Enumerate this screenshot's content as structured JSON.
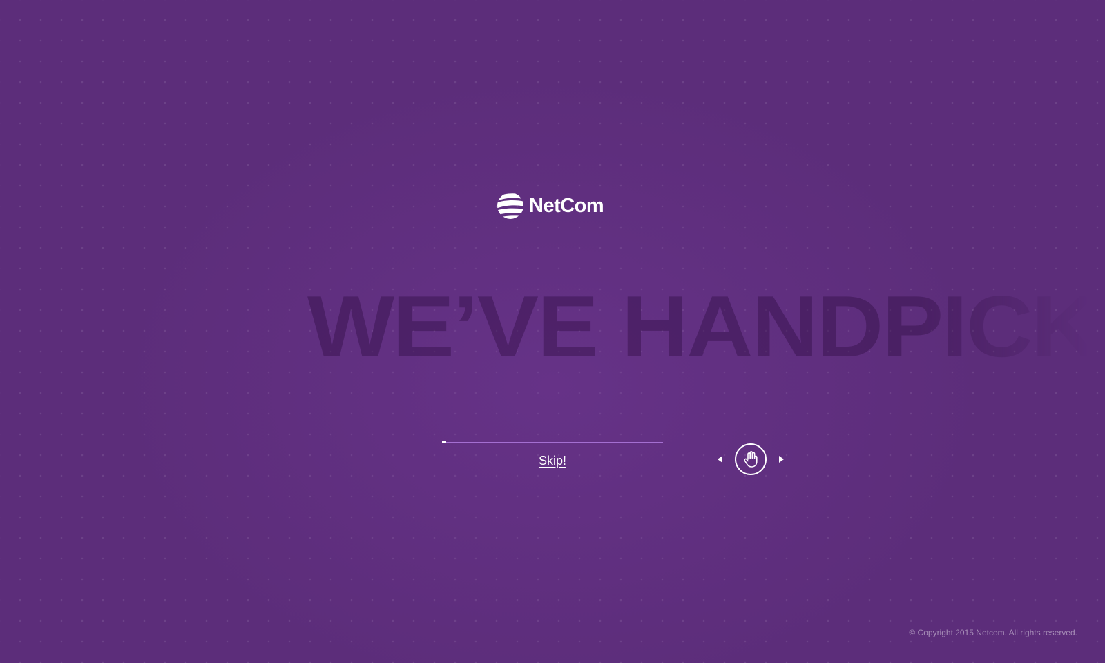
{
  "brand": {
    "name": "NetCom",
    "logo_icon": "netcom-globe-logo-icon"
  },
  "intro": {
    "headline": "WE’VE HANDPICKED"
  },
  "progress": {
    "fraction": 0.02
  },
  "skip": {
    "label": "Skip!"
  },
  "nav": {
    "prev_icon": "triangle-left-icon",
    "drag_icon": "hand-icon",
    "next_icon": "triangle-right-icon"
  },
  "footer": {
    "copyright": "© Copyright 2015 Netcom. All rights reserved."
  },
  "colors": {
    "background": "#5c2d7a",
    "progress_track": "#a46fd1",
    "text": "#ffffff"
  }
}
